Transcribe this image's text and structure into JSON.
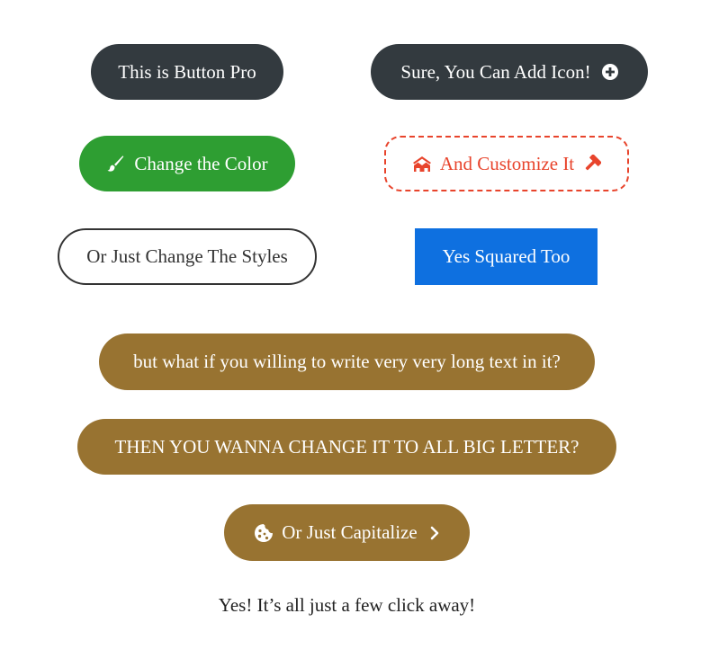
{
  "buttons": {
    "button_pro": {
      "label": "This is Button Pro",
      "bg": "#333a3f"
    },
    "add_icon": {
      "label": "Sure, You Can Add Icon!",
      "bg": "#333a3f",
      "icon": "plus-circle-icon"
    },
    "change_color": {
      "label": "Change the Color",
      "bg": "#2e9e32",
      "icon": "paintbrush-icon"
    },
    "customize": {
      "label": "And Customize It",
      "color": "#e8442c",
      "icon_left": "houses-icon",
      "icon_right": "hammer-icon"
    },
    "change_styles": {
      "label": "Or Just Change The Styles",
      "color": "#333333"
    },
    "squared": {
      "label": "Yes Squared Too",
      "bg": "#0e70e0"
    },
    "long_text": {
      "label": "but what if you willing to write very very long text in it?",
      "bg": "#987331"
    },
    "big_letter": {
      "label": "THEN YOU WANNA CHANGE IT TO ALL BIG LETTER?",
      "bg": "#987331"
    },
    "capitalize": {
      "label": "Or Just Capitalize",
      "bg": "#987331",
      "icon_left": "cookie-icon",
      "icon_right": "chevron-right-icon"
    }
  },
  "footer": {
    "text": "Yes! It’s all just a few click away!"
  }
}
